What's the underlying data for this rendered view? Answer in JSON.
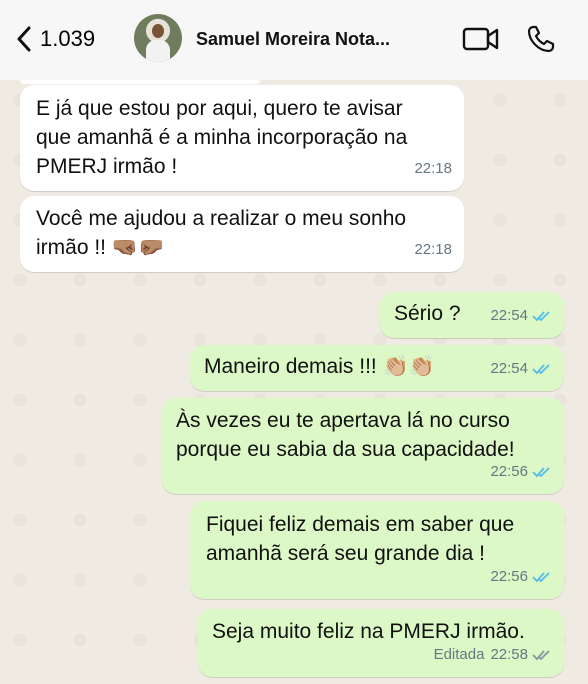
{
  "header": {
    "back_count": "1.039",
    "contact_name": "Samuel Moreira Nota...",
    "icons": [
      "chevron-left-icon",
      "video-camera-icon",
      "phone-icon"
    ]
  },
  "messages": [
    {
      "direction": "in",
      "text": "E já que estou por aqui, quero te avisar\nque amanhã é a minha incorporação na\nPMERJ irmão !",
      "time": "22:18"
    },
    {
      "direction": "in",
      "text": "Você me ajudou a realizar o meu sonho\nirmão !! 🤜🏽🤛🏽",
      "time": "22:18"
    },
    {
      "direction": "out",
      "text": "Sério ?",
      "time": "22:54",
      "status": "read"
    },
    {
      "direction": "out",
      "text": "Maneiro demais !!! 👏🏼👏🏼",
      "time": "22:54",
      "status": "read"
    },
    {
      "direction": "out",
      "text": "Às vezes eu te apertava lá no curso\nporque eu sabia da sua capacidade!",
      "time": "22:56",
      "status": "read"
    },
    {
      "direction": "out",
      "text": "Fiquei feliz demais em saber que\namanhã será seu grande dia !",
      "time": "22:56",
      "status": "read"
    },
    {
      "direction": "out",
      "text": "Seja muito feliz na PMERJ irmão.",
      "time": "22:58",
      "edited_label": "Editada",
      "status": "delivered"
    }
  ],
  "colors": {
    "incoming": "#ffffff",
    "outgoing": "#dcf8c6",
    "read_ticks": "#53bdeb",
    "delivered_ticks": "#8696a0",
    "chat_bg": "#efeae2"
  }
}
